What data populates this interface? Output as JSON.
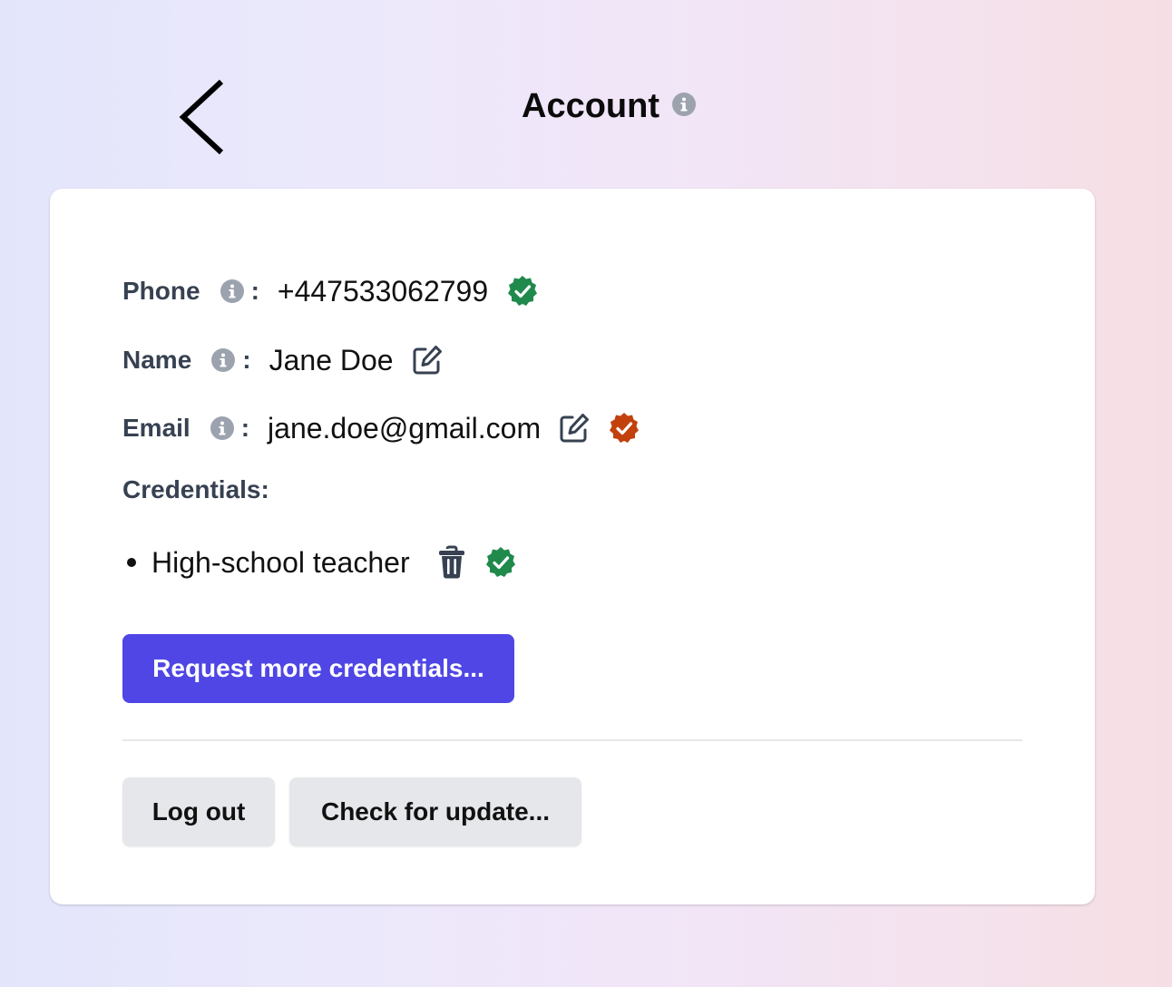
{
  "header": {
    "title": "Account",
    "back_icon": "chevron-left-icon",
    "info_icon": "info-circle-icon"
  },
  "fields": {
    "phone": {
      "label": "Phone",
      "colon": ":",
      "value": "+447533062799",
      "verified": true,
      "badge_color": "#1f8a4c"
    },
    "name": {
      "label": "Name",
      "colon": ":",
      "value": "Jane Doe",
      "editable": true
    },
    "email": {
      "label": "Email",
      "colon": ":",
      "value": "jane.doe@gmail.com",
      "editable": true,
      "verified": false,
      "badge_color": "#c2410c"
    }
  },
  "credentials": {
    "heading": "Credentials:",
    "items": [
      {
        "label": "High-school teacher",
        "verified": true,
        "badge_color": "#1f8a4c"
      }
    ]
  },
  "actions": {
    "request_label": "Request more credentials...",
    "logout_label": "Log out",
    "update_label": "Check for update..."
  },
  "colors": {
    "primary": "#4f46e5",
    "secondary_button": "#e5e7eb",
    "label": "#374151",
    "info_icon": "#9ca3af"
  }
}
